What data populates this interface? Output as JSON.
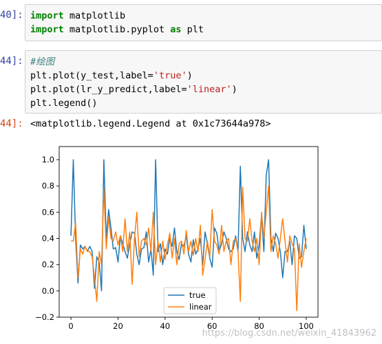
{
  "cells": [
    {
      "prompt": "40]:",
      "lines": [
        [
          {
            "t": "import",
            "c": "kw"
          },
          {
            "t": " matplotlib",
            "c": ""
          }
        ],
        [
          {
            "t": "import",
            "c": "kw"
          },
          {
            "t": " matplotlib.pyplot ",
            "c": ""
          },
          {
            "t": "as",
            "c": "kw"
          },
          {
            "t": " plt",
            "c": ""
          }
        ]
      ]
    },
    {
      "prompt": "44]:",
      "lines": [
        [
          {
            "t": "#绘图",
            "c": "cm"
          }
        ],
        [
          {
            "t": "plt.plot(y_test,label=",
            "c": ""
          },
          {
            "t": "'true'",
            "c": "st"
          },
          {
            "t": ")",
            "c": ""
          }
        ],
        [
          {
            "t": "plt.plot(lr_y_predict,label=",
            "c": ""
          },
          {
            "t": "'linear'",
            "c": "st"
          },
          {
            "t": ")",
            "c": ""
          }
        ],
        [
          {
            "t": "plt.legend()",
            "c": ""
          }
        ]
      ]
    }
  ],
  "output": {
    "prompt": "44]:",
    "text": "<matplotlib.legend.Legend at 0x1c73644a978>"
  },
  "chart_data": {
    "type": "line",
    "xlim": [
      -5,
      105
    ],
    "ylim": [
      -0.2,
      1.1
    ],
    "xticks": [
      0,
      20,
      40,
      60,
      80,
      100
    ],
    "yticks": [
      -0.2,
      0.0,
      0.2,
      0.4,
      0.6,
      0.8,
      1.0
    ],
    "xtick_labels": [
      "0",
      "20",
      "40",
      "60",
      "80",
      "100"
    ],
    "ytick_labels": [
      "−0.2",
      "0.0",
      "0.2",
      "0.4",
      "0.6",
      "0.8",
      "1.0"
    ],
    "legend_position": "lower-center",
    "series": [
      {
        "name": "true",
        "color": "#1f77b4",
        "values": [
          0.42,
          1.0,
          0.4,
          0.06,
          0.35,
          0.32,
          0.34,
          0.3,
          0.34,
          0.3,
          0.02,
          0.26,
          0.22,
          0.0,
          1.0,
          0.4,
          0.62,
          0.48,
          0.32,
          0.33,
          0.22,
          0.42,
          0.36,
          0.3,
          0.25,
          0.36,
          0.45,
          0.44,
          0.28,
          0.2,
          0.32,
          0.33,
          0.45,
          0.22,
          0.32,
          0.12,
          1.0,
          0.3,
          0.36,
          0.2,
          0.32,
          0.28,
          0.4,
          0.34,
          0.48,
          0.3,
          0.24,
          0.36,
          0.34,
          0.42,
          0.28,
          0.22,
          0.39,
          0.28,
          0.32,
          0.4,
          0.2,
          0.45,
          0.36,
          0.25,
          0.18,
          0.48,
          0.44,
          0.3,
          0.36,
          0.45,
          0.4,
          0.32,
          0.3,
          0.32,
          0.42,
          0.3,
          0.95,
          0.4,
          0.3,
          0.45,
          0.35,
          0.3,
          0.45,
          0.25,
          0.35,
          0.58,
          0.3,
          0.88,
          1.0,
          0.4,
          0.3,
          0.44,
          0.4,
          0.3,
          0.1,
          0.3,
          0.3,
          0.38,
          0.2,
          0.42,
          0.4,
          0.25,
          0.26,
          0.5,
          0.32
        ]
      },
      {
        "name": "linear",
        "color": "#ff7f0e",
        "values": [
          0.38,
          0.38,
          0.52,
          0.1,
          0.32,
          0.28,
          0.34,
          0.3,
          0.3,
          0.26,
          0.1,
          -0.08,
          0.3,
          0.2,
          0.78,
          0.32,
          0.56,
          0.4,
          0.38,
          0.45,
          0.35,
          0.42,
          0.3,
          0.55,
          0.3,
          0.45,
          0.05,
          0.4,
          0.6,
          0.26,
          0.38,
          0.4,
          0.35,
          0.48,
          0.3,
          0.6,
          0.2,
          0.38,
          0.22,
          0.38,
          0.24,
          0.35,
          0.44,
          0.25,
          0.4,
          0.2,
          0.36,
          0.38,
          0.28,
          0.46,
          0.3,
          0.38,
          0.27,
          0.4,
          0.3,
          0.5,
          0.12,
          0.24,
          0.38,
          0.26,
          0.62,
          0.38,
          0.35,
          0.28,
          0.5,
          0.3,
          0.38,
          0.4,
          0.2,
          0.38,
          0.4,
          0.3,
          -0.08,
          0.79,
          0.4,
          0.38,
          0.55,
          0.38,
          0.3,
          0.4,
          0.2,
          0.6,
          0.4,
          0.6,
          0.8,
          0.3,
          0.42,
          0.36,
          0.25,
          0.4,
          0.55,
          0.38,
          0.22,
          0.42,
          0.36,
          0.32,
          -0.15,
          0.36,
          0.18,
          0.3,
          0.4
        ]
      }
    ]
  },
  "watermark": "https://blog.csdn.net/weixin_41843962"
}
